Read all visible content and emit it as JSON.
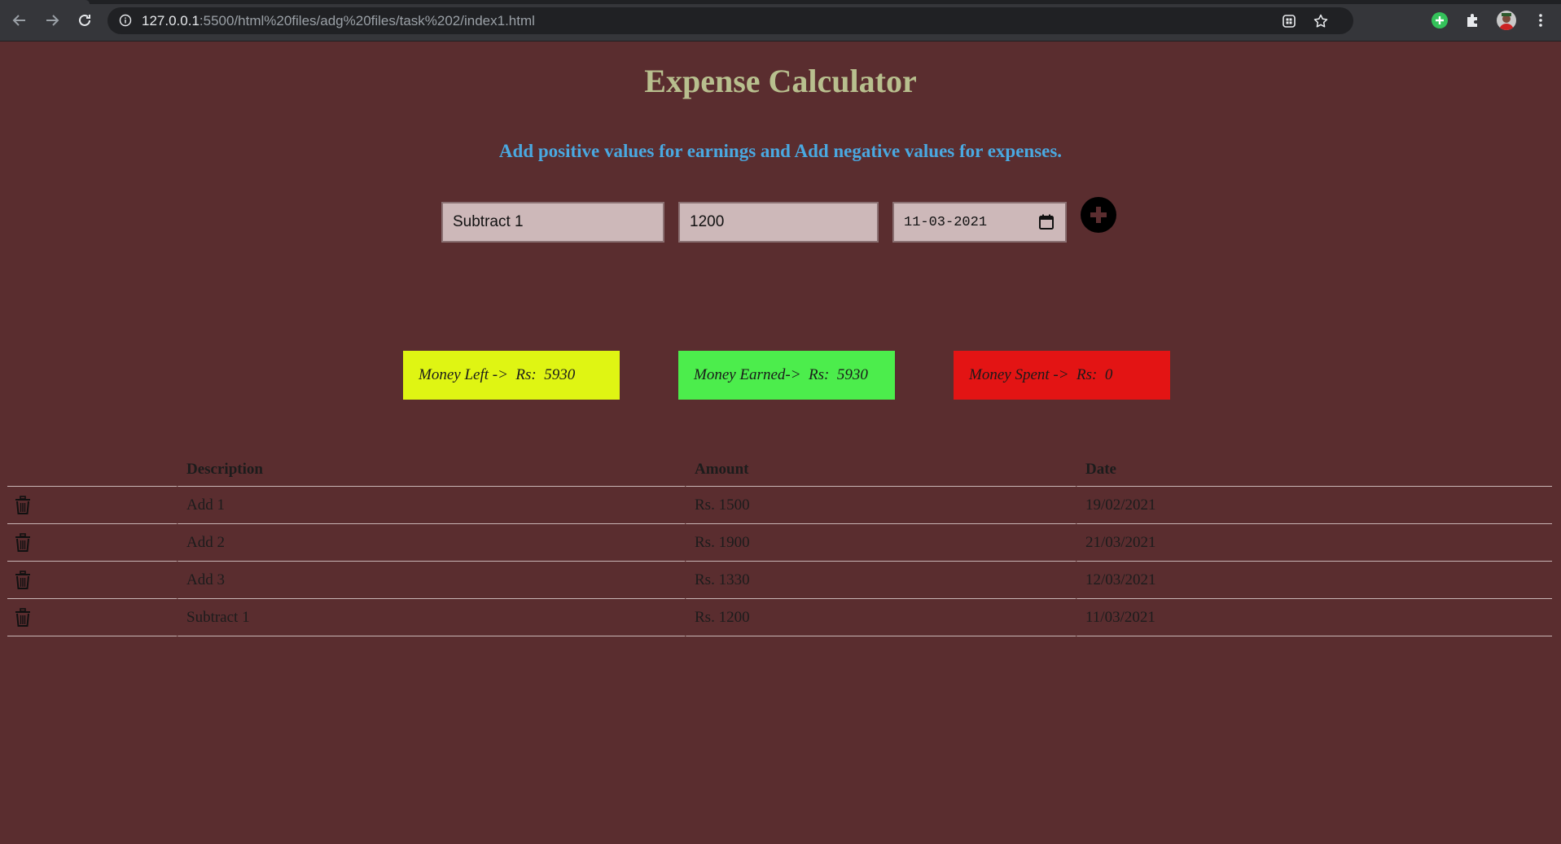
{
  "browser": {
    "url_host": "127.0.0.1",
    "url_rest": ":5500/html%20files/adg%20files/task%202/index1.html",
    "icons": [
      "back-icon",
      "forward-icon",
      "reload-icon",
      "info-icon",
      "apps-icon",
      "star-icon",
      "add-extension-icon",
      "puzzle-icon",
      "avatar",
      "menu-icon"
    ]
  },
  "page": {
    "title": "Expense Calculator",
    "subtitle": "Add positive values for earnings and Add negative values for expenses."
  },
  "form": {
    "description_value": "Subtract 1",
    "amount_value": "1200",
    "date_value": "11-03-2021",
    "add_icon": "plus-circle-icon"
  },
  "summary": {
    "left_label": "Money Left ->  Rs:  5930",
    "earned_label": "Money Earned->  Rs:  5930",
    "spent_label": "Money Spent ->  Rs:  0",
    "colors": {
      "left": "#dff513",
      "earned": "#4ced4c",
      "spent": "#e31414"
    }
  },
  "table": {
    "headers": {
      "description": "Description",
      "amount": "Amount",
      "date": "Date"
    },
    "rows": [
      {
        "description": "Add 1",
        "amount": "Rs. 1500",
        "date": "19/02/2021"
      },
      {
        "description": "Add 2",
        "amount": "Rs. 1900",
        "date": "21/03/2021"
      },
      {
        "description": "Add 3",
        "amount": "Rs. 1330",
        "date": "12/03/2021"
      },
      {
        "description": "Subtract 1",
        "amount": "Rs. 1200",
        "date": "11/03/2021"
      }
    ]
  },
  "colors": {
    "background": "#5a2d2f",
    "title": "#b8bf8e",
    "subtitle": "#4aa8e0",
    "input_bg": "#cdb8b9"
  }
}
